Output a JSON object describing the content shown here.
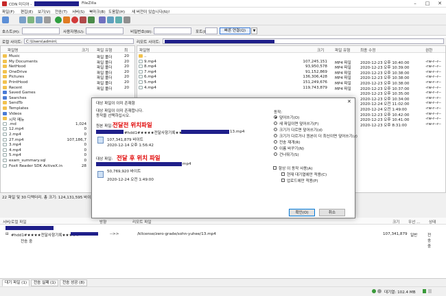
{
  "window": {
    "title": "CDN 미디어 -",
    "app_suffix": "FileZilla"
  },
  "menu": [
    "파일(F)",
    "편집(E)",
    "보기(V)",
    "전송(T)",
    "서버(S)",
    "북마크(B)",
    "도움말(H)",
    "새 버전이 있습니다(N)!"
  ],
  "quickconnect": {
    "host_label": "호스트(H):",
    "user_label": "사용자명(U):",
    "pass_label": "비밀번호(W):",
    "port_label": "포트(P):",
    "connect_label": "빠른 연결(Q)",
    "dropdown_glyph": "▼"
  },
  "local": {
    "site_label": "로컬 사이트:",
    "path": "C:\\Users\\admin\\",
    "columns": [
      "파일명",
      "크기",
      "파일 유형",
      "최"
    ],
    "rows": [
      {
        "name": "Music",
        "size": "",
        "type": "파일 폴더",
        "mod": "20",
        "kind": "folder"
      },
      {
        "name": "My Documents",
        "size": "",
        "type": "파일 폴더",
        "mod": "20",
        "kind": "folder"
      },
      {
        "name": "NetHood",
        "size": "",
        "type": "파일 폴더",
        "mod": "20",
        "kind": "folder"
      },
      {
        "name": "OneDrive",
        "size": "",
        "type": "파일 폴더",
        "mod": "20",
        "kind": "folder"
      },
      {
        "name": "Pictures",
        "size": "",
        "type": "파일 폴더",
        "mod": "20",
        "kind": "folder"
      },
      {
        "name": "PrintHood",
        "size": "",
        "type": "파일 폴더",
        "mod": "20",
        "kind": "folder"
      },
      {
        "name": "Recent",
        "size": "",
        "type": "파일 폴더",
        "mod": "20",
        "kind": "folder"
      },
      {
        "name": "Saved Games",
        "size": "",
        "type": "",
        "mod": "",
        "kind": "sys"
      },
      {
        "name": "Searches",
        "size": "",
        "type": "",
        "mod": "",
        "kind": "sys"
      },
      {
        "name": "SendTo",
        "size": "",
        "type": "",
        "mod": "",
        "kind": "folder"
      },
      {
        "name": "Templates",
        "size": "",
        "type": "",
        "mod": "",
        "kind": "folder"
      },
      {
        "name": "Videos",
        "size": "",
        "type": "",
        "mod": "",
        "kind": "sys"
      },
      {
        "name": "시작 메뉴",
        "size": "",
        "type": "",
        "mod": "",
        "kind": "folder"
      },
      {
        "name": ".md",
        "size": "1,024",
        "type": "",
        "mod": "",
        "kind": "file"
      },
      {
        "name": "12.mp4",
        "size": "0",
        "type": "",
        "mod": "",
        "kind": "file"
      },
      {
        "name": "2.mp4",
        "size": "0",
        "type": "",
        "mod": "",
        "kind": "file"
      },
      {
        "name": "27.mp4",
        "size": "107,186,7",
        "type": "",
        "mod": "",
        "kind": "file"
      },
      {
        "name": "3.mp4",
        "size": "0",
        "type": "",
        "mod": "",
        "kind": "file"
      },
      {
        "name": "4.mp4",
        "size": "0",
        "type": "",
        "mod": "",
        "kind": "file"
      },
      {
        "name": "5.mp4",
        "size": "0",
        "type": "",
        "mod": "",
        "kind": "file"
      },
      {
        "name": "exam_summary.sql",
        "size": "0",
        "type": "",
        "mod": "",
        "kind": "file"
      },
      {
        "name": "Foxit Reader SDK ActiveX.in",
        "size": "28",
        "type": "",
        "mod": "",
        "kind": "file"
      }
    ],
    "status": "22 파일 및 30 디렉터리. 총 크기: 124,131,595 바이트"
  },
  "remote": {
    "site_label": "리모트 사이트:",
    "columns": [
      "파일명",
      "크기",
      "파일 유형",
      "최종 수정",
      "권한"
    ],
    "rows": [
      {
        "name": "..",
        "size": "",
        "type": "",
        "mod": "",
        "perm": "",
        "kind": "folder"
      },
      {
        "name": "9.mp4",
        "size": "107,245,151",
        "type": "MP4 파일",
        "mod": "2020-12-23 오후 10:40:00",
        "perm": "-rw-r--r--",
        "kind": "file"
      },
      {
        "name": "8.mp4",
        "size": "93,950,578",
        "type": "MP4 파일",
        "mod": "2020-12-23 오후 10:39:00",
        "perm": "-rw-r--r--",
        "kind": "file"
      },
      {
        "name": "7.mp4",
        "size": "91,152,869",
        "type": "MP4 파일",
        "mod": "2020-12-23 오후 10:38:00",
        "perm": "-rw-r--r--",
        "kind": "file"
      },
      {
        "name": "6.mp4",
        "size": "136,306,428",
        "type": "MP4 파일",
        "mod": "2020-12-23 오후 10:38:00",
        "perm": "-rw-r--r--",
        "kind": "file"
      },
      {
        "name": "5.mp4",
        "size": "151,249,676",
        "type": "MP4 파일",
        "mod": "2020-12-23 오후 10:38:00",
        "perm": "-rw-r--r--",
        "kind": "file"
      },
      {
        "name": "4.mp4",
        "size": "119,743,879",
        "type": "MP4 파일",
        "mod": "2020-12-23 오후 10:37:00",
        "perm": "-rw-r--r--",
        "kind": "file"
      },
      {
        "name": "",
        "size": "",
        "type": "",
        "mod": "2020-12-23 오후 10:35:00",
        "perm": "-rw-r--r--",
        "kind": "none"
      },
      {
        "name": "",
        "size": "",
        "type": "",
        "mod": "2020-12-23 오후 10:34:00",
        "perm": "-rw-r--r--",
        "kind": "none"
      },
      {
        "name": "",
        "size": "",
        "type": "",
        "mod": "2020-12-24 오전 11:02:00",
        "perm": "-rw-r--r--",
        "kind": "none"
      },
      {
        "name": "",
        "size": "",
        "type": "",
        "mod": "2020-12-24 오전 1:49:00",
        "perm": "-rw-r--r--",
        "kind": "none"
      },
      {
        "name": "",
        "size": "",
        "type": "",
        "mod": "2020-12-23 오후 10:42:00",
        "perm": "-rw-r--r--",
        "kind": "none"
      },
      {
        "name": "",
        "size": "",
        "type": "",
        "mod": "2020-12-23 오후 10:41:00",
        "perm": "-rw-r--r--",
        "kind": "none"
      },
      {
        "name": "",
        "size": "",
        "type": "",
        "mod": "2020-12-23 오후 8:31:00",
        "perm": "-rw-r--r--",
        "kind": "none"
      }
    ]
  },
  "dialog": {
    "title": "대상 파일이 이미 존재함",
    "close": "✕",
    "line1": "대상 파일이 이미 존재합니다.",
    "line2": "동작을 선택하십시오.",
    "source_label": "원본 파일:",
    "source_annot": "전달전 위치파일",
    "source_name": "#hdd1#★★★★전달사항기록★★★★#",
    "source_name_end": "13.mp4",
    "source_size": "107,341,879 바이트",
    "source_date": "2020-12-14 오후 1:56:42",
    "target_label": "대상 파일:",
    "target_annot": "전달 후 위치 파일",
    "target_name_end": "mp4",
    "target_size": "50,769,920 바이트",
    "target_date": "2020-12-24 오전 1:49:00",
    "action_label": "동작:",
    "actions": [
      "덮어쓰기(O)",
      "새 파일이면 덮어쓰기(F)",
      "크기가 다르면 덮어쓰기(d)",
      "크기가 다르거나 원본이 더 최신이면 덮어쓰기(z)",
      "전송 재개(R)",
      "이름 바꾸기(N)",
      "건너뛰기(S)"
    ],
    "always_label": "항상 이 동작 사용(A)",
    "current_queue_label": "현재 대기열에만 적용(C)",
    "upload_only_label": "업로드에만 적용(P)",
    "ok": "확인(O)",
    "cancel": "취소"
  },
  "queue": {
    "columns": [
      "서버/로컬 파일",
      "방향",
      "리모트 파일",
      "크기",
      "우선 ...",
      "상태"
    ],
    "row": {
      "local": "#hdd1#★★★★전달사항기록★★★★#",
      "direction": "-->>",
      "remote": "/kllcense/zero-grade/sohn-yuhee/13.mp4",
      "size": "107,341,879",
      "priority": "일반",
      "status": "전송 중",
      "sub": "전송 중"
    },
    "tabs": [
      "대기 파일 (1)",
      "전송 실패 (1)",
      "전송 성공 (8)"
    ],
    "footer": "대기열: 102.4 MB"
  }
}
